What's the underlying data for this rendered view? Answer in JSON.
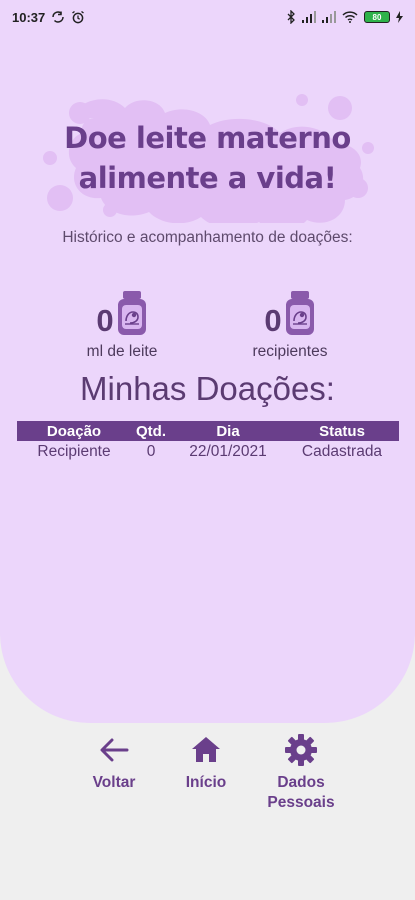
{
  "status_bar": {
    "time": "10:37",
    "battery": "80",
    "icons": [
      "sync-icon",
      "alarm-icon",
      "bluetooth-icon",
      "signal-icon",
      "signal-icon",
      "wifi-icon",
      "battery-icon",
      "charging-icon"
    ]
  },
  "banner": {
    "line1": "Doe leite materno",
    "line2": "alimente a vida!"
  },
  "subtitle": "Histórico e acompanhamento de doações:",
  "stats": [
    {
      "value": "0",
      "label": "ml de leite",
      "icon": "milk-jar-icon"
    },
    {
      "value": "0",
      "label": "recipientes",
      "icon": "milk-jar-icon"
    }
  ],
  "section_title": "Minhas Doações:",
  "table": {
    "headers": [
      "Doação",
      "Qtd.",
      "Dia",
      "Status"
    ],
    "rows": [
      [
        "Recipiente",
        "0",
        "22/01/2021",
        "Cadastrada"
      ]
    ]
  },
  "nav": {
    "back": "Voltar",
    "home": "Início",
    "personal_line1": "Dados",
    "personal_line2": "Pessoais"
  },
  "colors": {
    "panel": "#ecd6fb",
    "accent": "#6a3f8b",
    "background": "#efefef",
    "splash": "#e2bff4"
  }
}
